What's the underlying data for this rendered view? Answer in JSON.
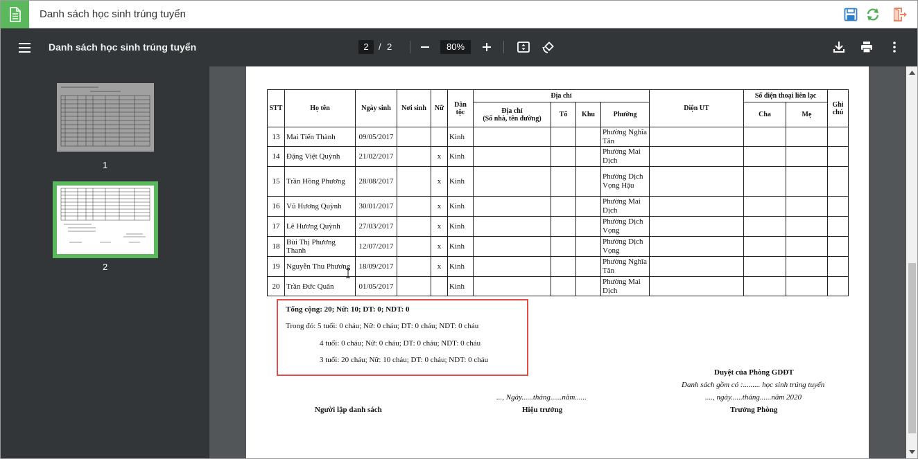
{
  "app": {
    "title": "Danh sách học sinh trúng tuyển",
    "accent": "#5cb85c",
    "actions": [
      "save-icon",
      "sync-icon",
      "exit-icon"
    ]
  },
  "toolbar": {
    "title": "Danh sách học sinh trúng tuyển",
    "current_page": "2",
    "separator": "/",
    "total_pages": "2",
    "zoom": "80%"
  },
  "sidebar": {
    "thumbnails": [
      {
        "label": "1",
        "selected": false
      },
      {
        "label": "2",
        "selected": true
      }
    ]
  },
  "table": {
    "headers": {
      "stt": "STT",
      "ho_ten": "Họ tên",
      "ngay_sinh": "Ngày sinh",
      "noi_sinh": "Nơi sinh",
      "nu": "Nữ",
      "dan_toc": "Dân tộc",
      "dia_chi": "Địa chỉ",
      "dia_chi_sub": "Địa chỉ",
      "dia_chi_sub2": "(Số nhà, tên đường)",
      "to": "Tổ",
      "khu": "Khu",
      "phuong": "Phường",
      "dien_ut": "Diện UT",
      "sdt": "Số điện thoại liên lạc",
      "cha": "Cha",
      "me": "Mẹ",
      "ghi_chu": "Ghi chú"
    },
    "rows": [
      {
        "stt": "13",
        "name": "Mai Tiến Thành",
        "dob": "09/05/2017",
        "nu": "",
        "dantoc": "Kinh",
        "phuong": "Phường Nghĩa Tân"
      },
      {
        "stt": "14",
        "name": "Đặng Việt Quỳnh",
        "dob": "21/02/2017",
        "nu": "x",
        "dantoc": "Kinh",
        "phuong": "Phường Mai Dịch"
      },
      {
        "stt": "15",
        "name": "Trần Hồng Phương",
        "dob": "28/08/2017",
        "nu": "x",
        "dantoc": "Kinh",
        "phuong": "Phường Dịch Vọng Hậu"
      },
      {
        "stt": "16",
        "name": "Vũ Hương Quỳnh",
        "dob": "30/01/2017",
        "nu": "x",
        "dantoc": "Kinh",
        "phuong": "Phường Mai Dịch"
      },
      {
        "stt": "17",
        "name": "Lê Hương Quỳnh",
        "dob": "27/03/2017",
        "nu": "x",
        "dantoc": "Kinh",
        "phuong": "Phường Dịch Vọng"
      },
      {
        "stt": "18",
        "name": "Bùi Thị Phương Thanh",
        "dob": "12/07/2017",
        "nu": "x",
        "dantoc": "Kinh",
        "phuong": "Phường Dịch Vọng"
      },
      {
        "stt": "19",
        "name": "Nguyễn Thu Phương",
        "dob": "18/09/2017",
        "nu": "x",
        "dantoc": "Kinh",
        "phuong": "Phường Nghĩa Tân"
      },
      {
        "stt": "20",
        "name": "Trần Đức Quân",
        "dob": "01/05/2017",
        "nu": "",
        "dantoc": "Kinh",
        "phuong": "Phường Mai Dịch"
      }
    ]
  },
  "summary": {
    "total": "Tổng cộng: 20; Nữ: 10;  DT: 0; NDT: 0",
    "line1": "Trong đó: 5 tuổi: 0 cháu; Nữ: 0 cháu; DT: 0 cháu; NDT: 0 cháu",
    "line2": "4 tuổi: 0 cháu; Nữ: 0 cháu; DT: 0 cháu; NDT: 0 cháu",
    "line3": "3 tuổi: 20 cháu; Nữ: 10 cháu; DT: 0 cháu; NDT: 0 cháu",
    "highlight_color": "#e04b4b"
  },
  "signatures": {
    "approval_title": "Duyệt của Phòng GDĐT",
    "approval_count": "Danh sách gồm có :......... học sinh trúng tuyển",
    "approval_date": "...., ngày......tháng......năm 2020",
    "principal_date": "..., Ngày......tháng......năm......",
    "creator": "Người lập danh sách",
    "principal": "Hiệu trưởng",
    "head": "Trưởng Phòng"
  }
}
